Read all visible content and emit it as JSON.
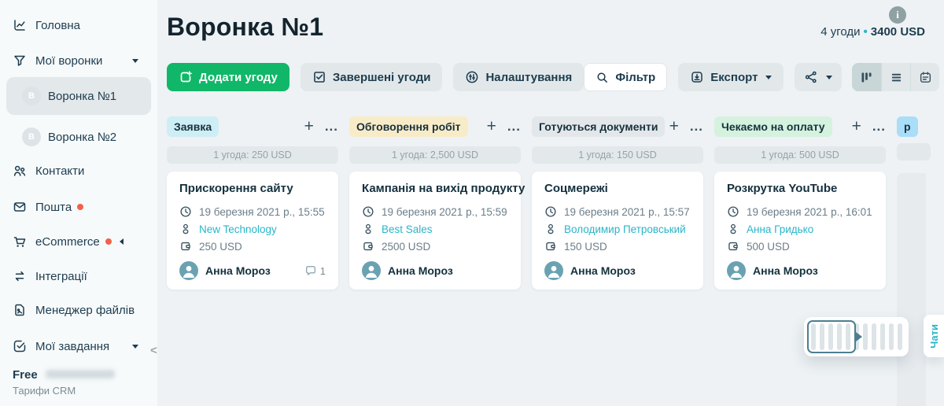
{
  "sidebar": {
    "items": [
      {
        "label": "Головна",
        "icon": "chart-line-icon"
      },
      {
        "label": "Мої воронки",
        "icon": "funnel-icon",
        "caret": "down"
      },
      {
        "label": "Воронка №1",
        "avatar_letter": "B",
        "selected": true
      },
      {
        "label": "Воронка №2",
        "avatar_letter": "B",
        "selected": false
      },
      {
        "label": "Контакти",
        "icon": "contacts-icon"
      },
      {
        "label": "Пошта",
        "icon": "mail-icon",
        "notification_dot": true
      },
      {
        "label": "eCommerce",
        "icon": "cart-icon",
        "notification_dot": true,
        "caret": "left"
      },
      {
        "label": "Інтеграції",
        "icon": "transfer-arrows-icon"
      },
      {
        "label": "Менеджер файлів",
        "icon": "file-icon"
      },
      {
        "label": "Мої завдання",
        "icon": "task-check-icon",
        "caret": "down"
      }
    ],
    "plan_name": "Free",
    "plan_link": "Тарифи CRM",
    "collapse_glyph": "<"
  },
  "header": {
    "title": "Воронка №1",
    "deals_count": "4 угоди",
    "separator": "•",
    "total_amount": "3400 USD"
  },
  "toolbar": {
    "add_deal_label": "Додати угоду",
    "completed_deals_label": "Завершені угоди",
    "settings_label": "Налаштування",
    "filter_label": "Фільтр",
    "export_label": "Експорт",
    "view_modes": [
      "kanban",
      "list",
      "calendar"
    ],
    "active_view": "kanban"
  },
  "board": {
    "plus_glyph": "+",
    "dots_glyph": "...",
    "columns": [
      {
        "name": "Заявка",
        "badge_bg": "#cdeef4",
        "stats": "1 угода: 250 USD",
        "cards": [
          {
            "title": "Прискорення сайту",
            "created": "19 березня 2021 р., 15:55",
            "contact": "New Technology",
            "amount": "250 USD",
            "manager": "Анна Мороз",
            "comments_count": "1"
          }
        ]
      },
      {
        "name": "Обговорення робіт",
        "badge_bg": "#f8ecc8",
        "stats": "1 угода: 2,500 USD",
        "cards": [
          {
            "title": "Кампанія на вихід продукту",
            "created": "19 березня 2021 р., 15:59",
            "contact": "Best Sales",
            "amount": "2500 USD",
            "manager": "Анна Мороз"
          }
        ]
      },
      {
        "name": "Готуються документи",
        "badge_bg": "#e3e7e9",
        "stats": "1 угода: 150 USD",
        "cards": [
          {
            "title": "Соцмережі",
            "created": "19 березня 2021 р., 15:57",
            "contact": "Володимир Петровський",
            "amount": "150 USD",
            "manager": "Анна Мороз"
          }
        ]
      },
      {
        "name": "Чекаємо на оплату",
        "badge_bg": "#d5f2de",
        "stats": "1 угода: 500 USD",
        "cards": [
          {
            "title": "Розкрутка YouTube",
            "created": "19 березня 2021 р., 16:01",
            "contact": "Анна Гридько",
            "amount": "500 USD",
            "manager": "Анна Мороз"
          }
        ]
      }
    ],
    "partial_column": {
      "name": "р",
      "badge_bg": "#a9ddf8"
    }
  },
  "chats_tab": {
    "label": "Чати"
  },
  "icons": [
    "info-icon",
    "search-icon",
    "export-box-icon",
    "flow-branch-icon",
    "kanban-view-icon",
    "list-view-icon",
    "calendar-view-icon",
    "add-deal-icon",
    "checkbox-icon",
    "sliders-icon",
    "clock-icon",
    "person-icon",
    "wallet-icon",
    "comment-bubble-icon",
    "avatar-person-icon"
  ],
  "colors": {
    "accent_green": "#10b768",
    "link_teal": "#2ab5c8",
    "text_dark": "#1d3c4e",
    "notification_dot": "#f4604a",
    "badge_zayavka": "#cdeef4",
    "badge_obgovorennya": "#f8ecc8",
    "badge_dokumenty": "#e3e7e9",
    "badge_oplata": "#d5f2de",
    "badge_partial": "#a9ddf8",
    "page_bg": "#eef2f4",
    "sidebar_bg": "#f7fafb"
  }
}
